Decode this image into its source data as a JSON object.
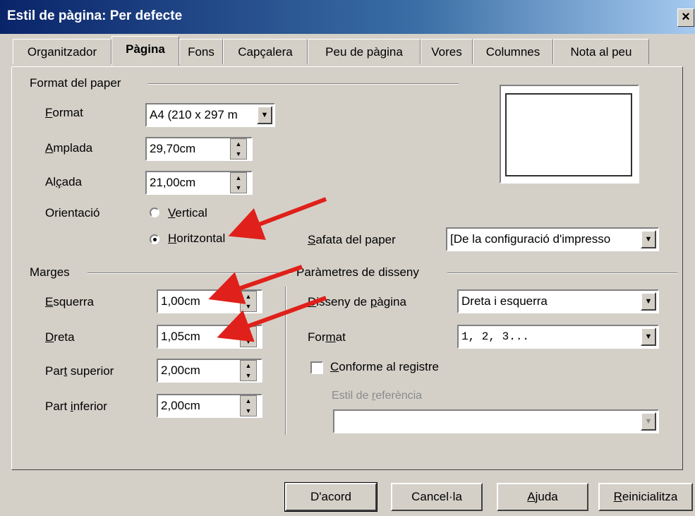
{
  "window": {
    "title": "Estil de pàgina: Per defecte",
    "close": "×"
  },
  "tabs": [
    {
      "label": "Organitzador"
    },
    {
      "label": "Pàgina"
    },
    {
      "label": "Fons"
    },
    {
      "label": "Capçalera"
    },
    {
      "label": "Peu de pàgina"
    },
    {
      "label": "Vores"
    },
    {
      "label": "Columnes"
    },
    {
      "label": "Nota al peu"
    }
  ],
  "paper_format": {
    "group_label": "Format del paper",
    "format_label": "Format",
    "format_value": "A4 (210 x 297 m",
    "width_label": "Amplada",
    "width_value": "29,70cm",
    "height_label": "Alçada",
    "height_value": "21,00cm",
    "orientation_label": "Orientació",
    "vertical_label": "Vertical",
    "horizontal_label": "Horitzontal",
    "selected_orientation": "Horitzontal",
    "tray_label": "Safata del paper",
    "tray_value": "[De la configuració d'impresso"
  },
  "margins": {
    "group_label": "Marges",
    "left_label": "Esquerra",
    "left_value": "1,00cm",
    "right_label": "Dreta",
    "right_value": "1,05cm",
    "top_label": "Part superior",
    "top_value": "2,00cm",
    "bottom_label": "Part inferior",
    "bottom_value": "2,00cm"
  },
  "layout": {
    "group_label": "Paràmetres de disseny",
    "page_layout_label": "Disseny de pàgina",
    "page_layout_value": "Dreta i esquerra",
    "format_label": "Format",
    "format_value": "1, 2, 3...",
    "register_label": "Conforme al registre",
    "register_checked": false,
    "reference_style_label": "Estil de referència",
    "reference_style_value": ""
  },
  "buttons": {
    "ok": "D'acord",
    "cancel": "Cancel·la",
    "help": "Ajuda",
    "reset": "Reinicialitza"
  },
  "colors": {
    "title_bar": "#0a246a",
    "dialog_bg": "#d4d0c8",
    "annotation_arrow": "#e0201a"
  }
}
